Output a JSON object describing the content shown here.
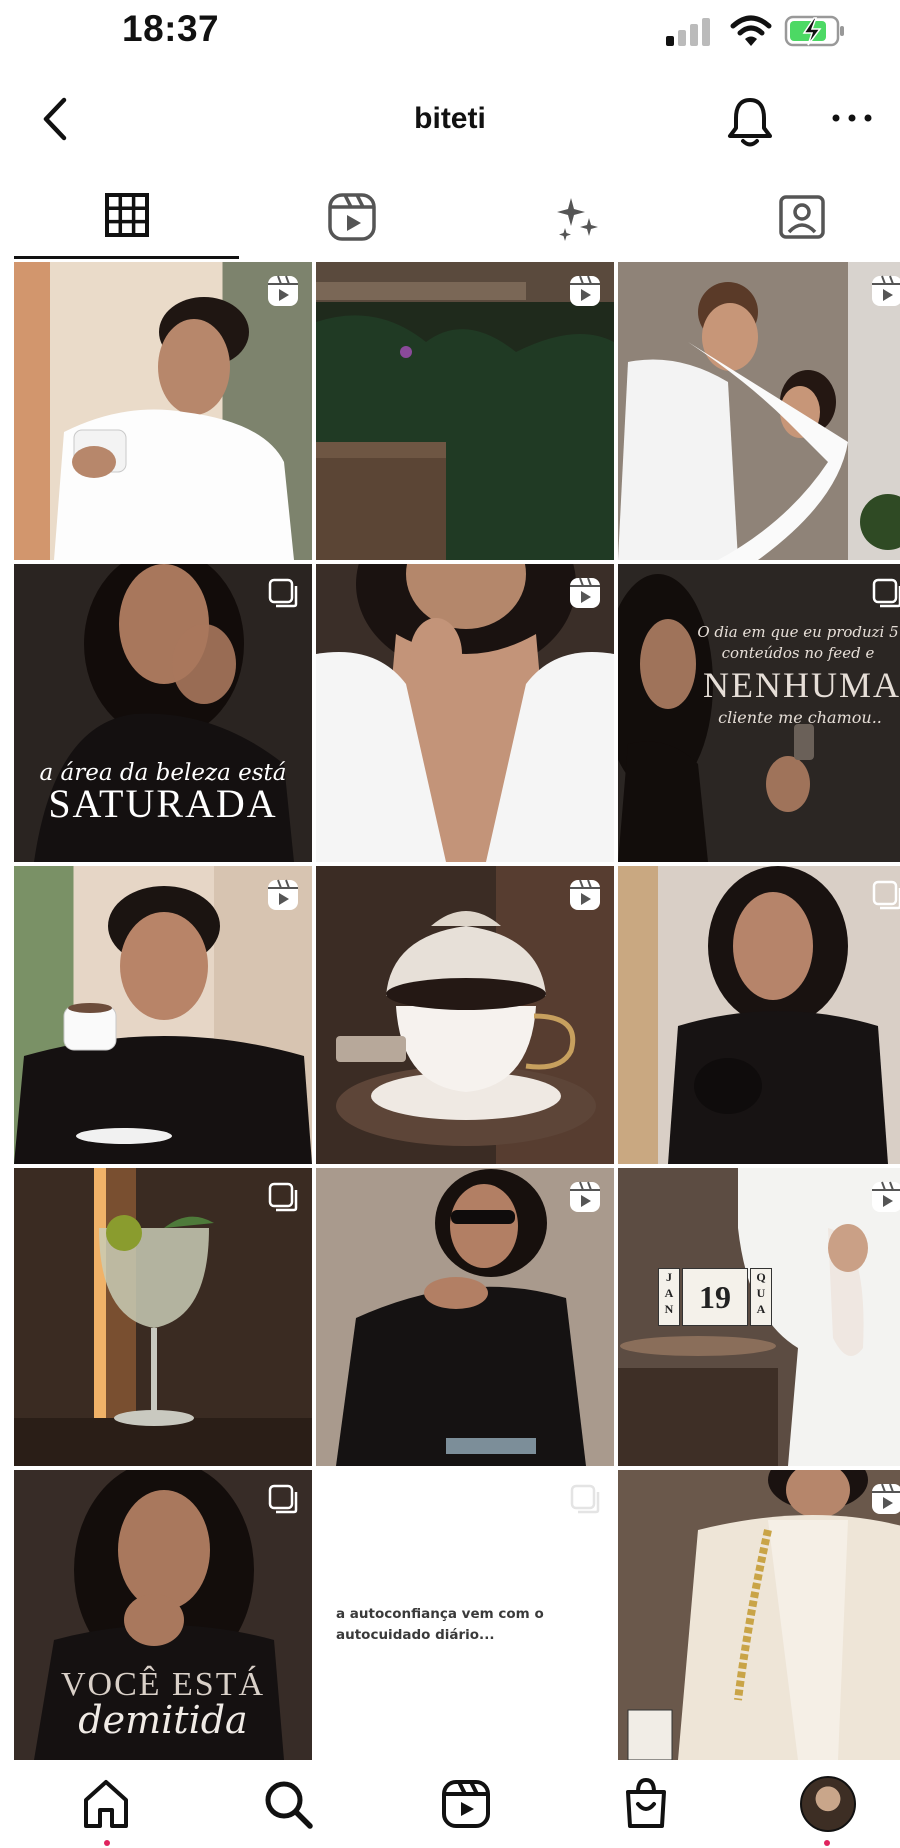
{
  "status": {
    "time": "18:37"
  },
  "header": {
    "username": "biteti"
  },
  "tabs": [
    {
      "name": "posts-grid",
      "active": true
    },
    {
      "name": "reels"
    },
    {
      "name": "collabs"
    },
    {
      "name": "tagged"
    }
  ],
  "posts": [
    {
      "badge": "reel-icon",
      "caption": ""
    },
    {
      "badge": "reel-icon",
      "caption": ""
    },
    {
      "badge": "reel-icon",
      "caption": ""
    },
    {
      "badge": "carousel-icon",
      "caption_small": "a área da beleza está",
      "caption_big": "SATURADA"
    },
    {
      "badge": "reel-icon",
      "caption": ""
    },
    {
      "badge": "carousel-icon",
      "caption_small": "O dia em que eu produzi 5 conteúdos no feed e",
      "caption_big": "NENHUMA",
      "caption_end": "cliente me chamou.."
    },
    {
      "badge": "reel-icon",
      "caption": ""
    },
    {
      "badge": "reel-icon",
      "caption": ""
    },
    {
      "badge": "carousel-icon",
      "caption": ""
    },
    {
      "badge": "carousel-icon",
      "caption": ""
    },
    {
      "badge": "reel-icon",
      "caption": ""
    },
    {
      "badge": "reel-icon",
      "caption": "",
      "calendar": [
        "J",
        "A",
        "N",
        "19",
        "Q",
        "U",
        "A"
      ]
    },
    {
      "badge": "carousel-icon",
      "caption_big": "VOCÊ ESTÁ",
      "caption_small": "demitida"
    },
    {
      "badge": "carousel-icon",
      "caption_dark": "a autoconfiança vem com o autocuidado diário..."
    },
    {
      "badge": "reel-icon",
      "caption": ""
    }
  ],
  "bottom_nav": [
    "home-icon",
    "search-icon",
    "reels-icon",
    "shop-icon",
    "profile-avatar"
  ]
}
